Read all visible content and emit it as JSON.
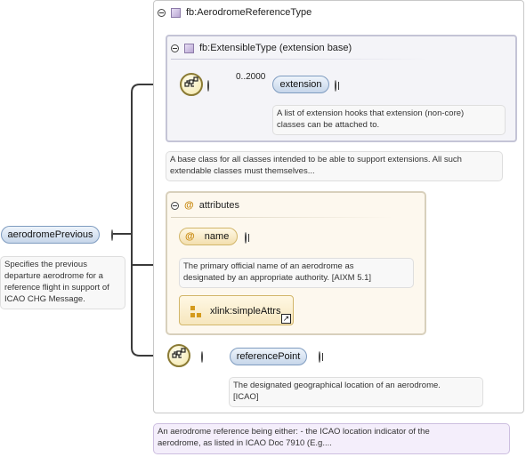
{
  "root": {
    "name": "aerodromePrevious",
    "doc": [
      "Specifies the previous",
      "departure aerodrome for a",
      "reference flight in support of",
      "ICAO CHG Message."
    ]
  },
  "type_panel": {
    "title": "fb:AerodromeReferenceType",
    "doc": [
      "An aerodrome reference being either: - the ICAO location indicator of the",
      "aerodrome, as listed in ICAO Doc 7910 (E.g...."
    ]
  },
  "ext_panel": {
    "title": "fb:ExtensibleType (extension base)",
    "occurrence": "0..2000",
    "element": "extension",
    "element_doc": [
      "A list of extension hooks that extension (non-core)",
      "classes can be attached to."
    ],
    "doc": [
      "A base class for all classes intended to be able to support extensions. All such",
      "extendable classes must themselves..."
    ]
  },
  "attributes": {
    "title": "attributes",
    "name_attr": "name",
    "name_doc": [
      "The primary official name of an aerodrome as",
      "designated by an appropriate authority. [AIXM 5.1]"
    ],
    "group": "xlink:simpleAttrs"
  },
  "ref_point": {
    "element": "referencePoint",
    "doc": [
      "The designated geographical location of an aerodrome.",
      "[ICAO]"
    ]
  },
  "icons": {
    "collapse": "minus-toggle-icon",
    "expand": "plus-toggle-icon",
    "type": "complex-type-icon",
    "sequence": "sequence-compositor-icon",
    "attribute": "attribute-at-icon",
    "group": "attribute-group-icon",
    "link": "reference-link-icon"
  },
  "colors": {
    "element_fill": "#c6d6ea",
    "attribute_fill": "#fdf8ee",
    "extension_fill": "#f4f4f8",
    "connector": "#3a3a3a"
  }
}
